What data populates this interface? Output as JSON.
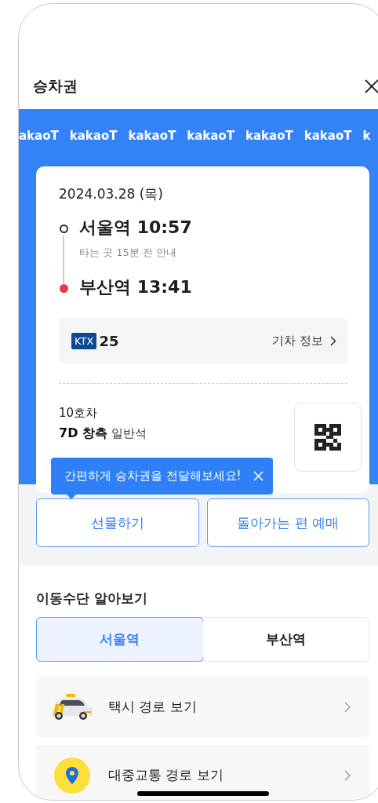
{
  "header": {
    "title": "승차권"
  },
  "pattern": [
    "akaoT",
    "kakaoT",
    "kakaoT",
    "kakaoT",
    "kakaoT",
    "kakaoT",
    "k"
  ],
  "ticket": {
    "date": "2024.03.28 (목)",
    "stops": [
      {
        "kind": "departure",
        "station": "서울역",
        "time": "10:57",
        "note": "타는 곳 15분 전 안내"
      },
      {
        "kind": "arrival",
        "station": "부산역",
        "time": "13:41"
      }
    ],
    "train": {
      "badge": "KTX",
      "number": "25",
      "link": "기차 정보"
    },
    "car": "10호차",
    "seat": "7D",
    "position": "창측",
    "class": "일반석"
  },
  "tooltip": {
    "text": "간편하게 승차권을 전달해보세요!"
  },
  "actions": [
    "선물하기",
    "돌아가는 편 예매"
  ],
  "transport": {
    "title": "이동수단 알아보기",
    "tabs": [
      {
        "label": "서울역",
        "selected": true
      },
      {
        "label": "부산역",
        "selected": false
      }
    ],
    "items": [
      {
        "kind": "taxi",
        "label": "택시 경로 보기"
      },
      {
        "kind": "transit",
        "label": "대중교통 경로 보기"
      }
    ]
  }
}
